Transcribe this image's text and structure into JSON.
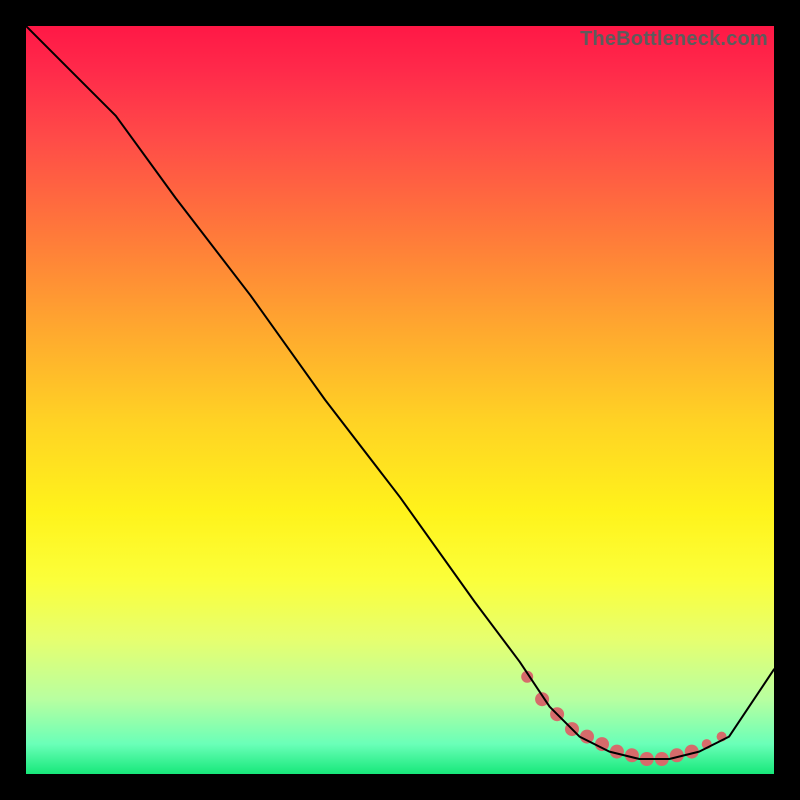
{
  "attribution": "TheBottleneck.com",
  "chart_data": {
    "type": "line",
    "title": "",
    "xlabel": "",
    "ylabel": "",
    "xlim": [
      0,
      100
    ],
    "ylim": [
      0,
      100
    ],
    "background_gradient": {
      "top": "#ff1846",
      "mid": "#fff31b",
      "bottom": "#17e87a"
    },
    "series": [
      {
        "name": "bottleneck-curve",
        "color": "#000000",
        "x": [
          0,
          6,
          12,
          20,
          30,
          40,
          50,
          60,
          66,
          70,
          74,
          78,
          82,
          86,
          90,
          94,
          100
        ],
        "values": [
          100,
          94,
          88,
          77,
          64,
          50,
          37,
          23,
          15,
          9,
          5,
          3,
          2,
          2,
          3,
          5,
          14
        ]
      }
    ],
    "markers": {
      "name": "bottleneck-dots",
      "color": "#d66b6b",
      "x": [
        67,
        69,
        71,
        73,
        75,
        77,
        79,
        81,
        83,
        85,
        87,
        89,
        91,
        93
      ],
      "values": [
        13,
        10,
        8,
        6,
        5,
        4,
        3,
        2.5,
        2,
        2,
        2.5,
        3,
        4,
        5
      ],
      "radius": [
        6,
        7,
        7,
        7,
        7,
        7,
        7,
        7,
        7,
        7,
        7,
        7,
        5,
        5
      ]
    }
  }
}
